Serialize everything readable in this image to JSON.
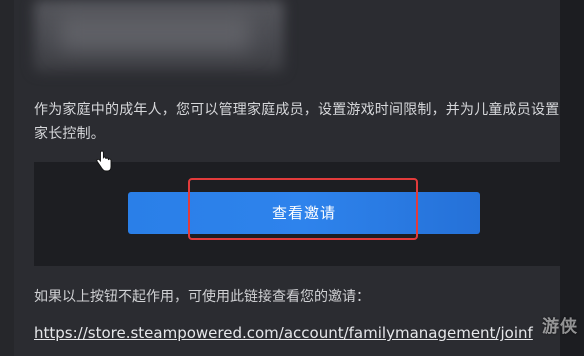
{
  "email": {
    "intro_text": "作为家庭中的成年人，您可以管理家庭成员，设置游戏时间限制，并为儿童成员设置家长控制。",
    "view_invite_label": "查看邀请",
    "fallback_text": "如果以上按钮不起作用，可使用此链接查看您的邀请：",
    "fallback_link": "https://store.steampowered.com/account/familymanagement/joinf"
  },
  "watermark": "游侠",
  "colors": {
    "background": "#2b2c31",
    "panel": "#1d1e22",
    "button": "#2a7fe8",
    "highlight": "#e23b3b"
  },
  "icons": [
    "hand-pointer-icon"
  ]
}
